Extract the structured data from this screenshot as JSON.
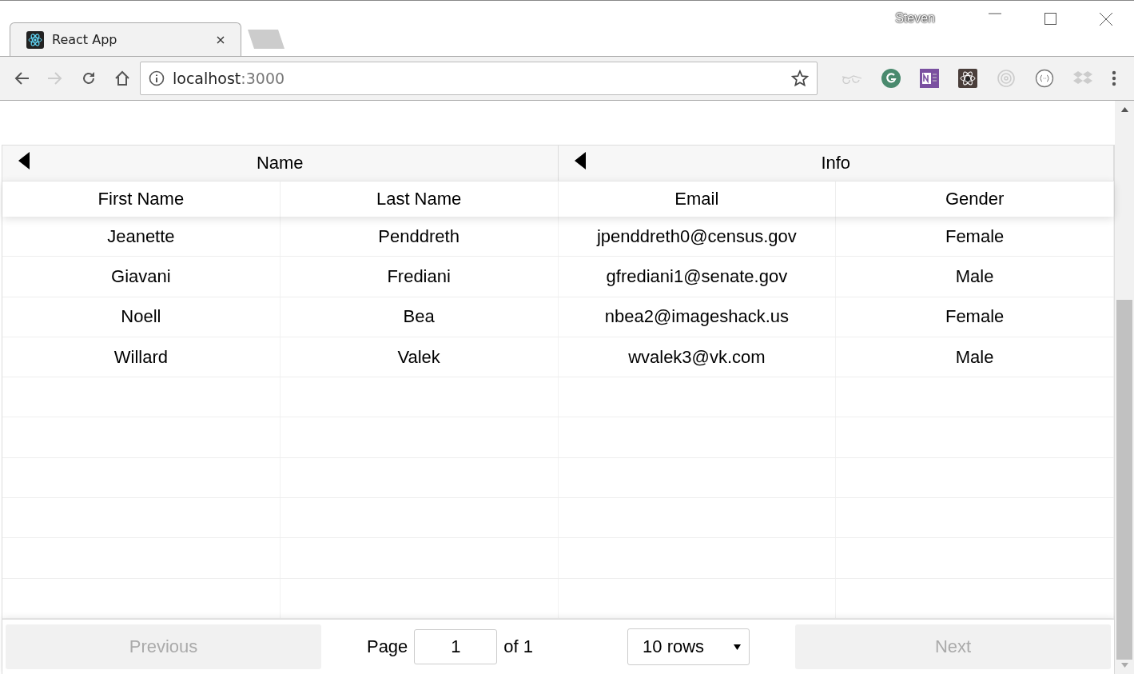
{
  "browser": {
    "profile": "Steven",
    "tabs": [
      {
        "title": "React App",
        "selected": true
      }
    ],
    "address": {
      "host": "localhost",
      "port": ":3000"
    }
  },
  "table": {
    "header_groups": [
      {
        "label": "Name"
      },
      {
        "label": "Info"
      }
    ],
    "columns": [
      "First Name",
      "Last Name",
      "Email",
      "Gender"
    ],
    "rows": [
      [
        "Jeanette",
        "Penddreth",
        "jpenddreth0@census.gov",
        "Female"
      ],
      [
        "Giavani",
        "Frediani",
        "gfrediani1@senate.gov",
        "Male"
      ],
      [
        "Noell",
        "Bea",
        "nbea2@imageshack.us",
        "Female"
      ],
      [
        "Willard",
        "Valek",
        "wvalek3@vk.com",
        "Male"
      ]
    ]
  },
  "pagination": {
    "previous": {
      "label": "Previous",
      "disabled": true
    },
    "page_label": "Page",
    "page": "1",
    "of": "of 1",
    "page_size": "10 rows",
    "next": {
      "label": "Next",
      "disabled": true
    }
  }
}
